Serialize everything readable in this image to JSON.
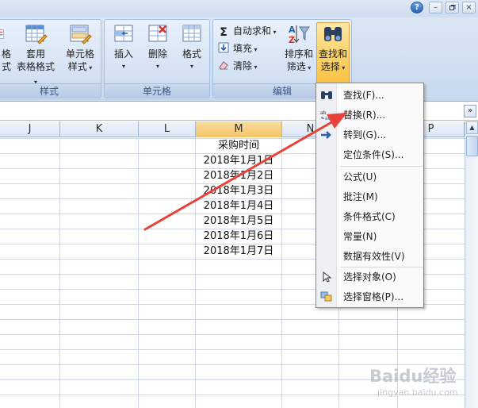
{
  "window": {
    "help_glyph": "?",
    "minimize_glyph": "–",
    "close_glyph": "×"
  },
  "ribbon": {
    "style_group": {
      "caption": "样式",
      "partial_label": "格式",
      "format_as_table_line1": "套用",
      "format_as_table_line2": "表格格式",
      "cell_styles_line1": "单元格",
      "cell_styles_line2": "样式"
    },
    "cells_group": {
      "caption": "单元格",
      "insert": "插入",
      "delete": "删除",
      "format": "格式"
    },
    "editing_group": {
      "caption": "编辑",
      "autosum": "自动求和",
      "fill": "填充",
      "clear": "清除",
      "sort_filter_line1": "排序和",
      "sort_filter_line2": "筛选",
      "find_select_line1": "查找和",
      "find_select_line2": "选择"
    }
  },
  "formula_bar": {
    "expand_glyph": "»"
  },
  "columns": [
    "J",
    "K",
    "L",
    "M",
    "N",
    "P"
  ],
  "sheet": {
    "header_cell": "采购时间",
    "dates": [
      "2018年1月1日",
      "2018年1月2日",
      "2018年1月3日",
      "2018年1月4日",
      "2018年1月5日",
      "2018年1月6日",
      "2018年1月7日"
    ]
  },
  "menu": {
    "items": [
      {
        "label": "查找(F)...",
        "icon": "binoculars-icon"
      },
      {
        "label": "替换(R)...",
        "icon": "replace-icon"
      },
      {
        "label": "转到(G)...",
        "icon": "goto-arrow-icon"
      },
      {
        "label": "定位条件(S)...",
        "icon": ""
      },
      {
        "label": "公式(U)",
        "icon": ""
      },
      {
        "label": "批注(M)",
        "icon": ""
      },
      {
        "label": "条件格式(C)",
        "icon": ""
      },
      {
        "label": "常量(N)",
        "icon": ""
      },
      {
        "label": "数据有效性(V)",
        "icon": ""
      },
      {
        "label": "选择对象(O)",
        "icon": "pointer-icon"
      },
      {
        "label": "选择窗格(P)...",
        "icon": "selection-pane-icon"
      }
    ]
  },
  "annotation": {
    "arrow_color": "#e8413a"
  },
  "watermark": {
    "brand": "Baidu经验",
    "url": "jingyan.baidu.com"
  }
}
